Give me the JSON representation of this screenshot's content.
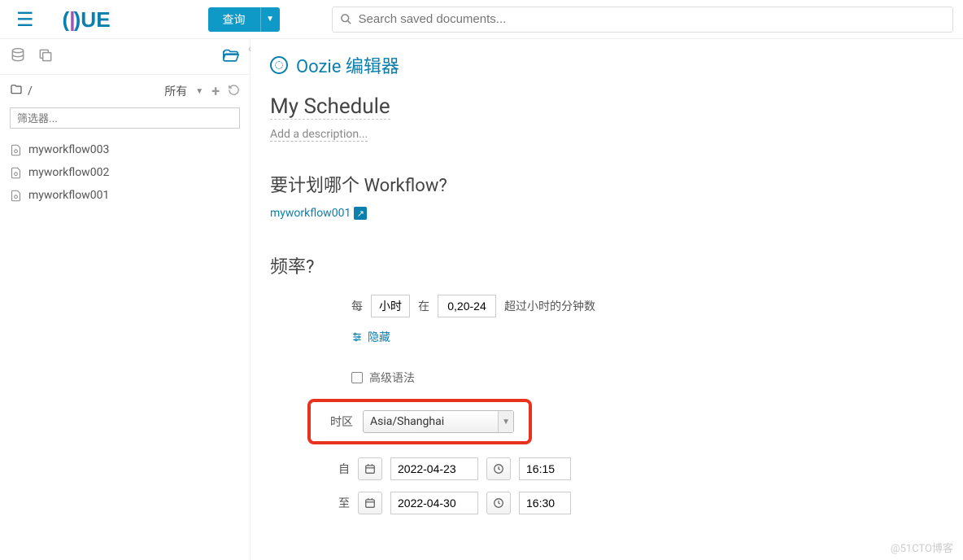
{
  "topbar": {
    "query_label": "查询",
    "search_placeholder": "Search saved documents..."
  },
  "sidebar": {
    "path": "/",
    "filter_label": "所有",
    "filter_placeholder": "筛选器...",
    "files": [
      {
        "name": "myworkflow003"
      },
      {
        "name": "myworkflow002"
      },
      {
        "name": "myworkflow001"
      }
    ]
  },
  "editor": {
    "title": "Oozie 编辑器",
    "schedule_name": "My Schedule",
    "add_description": "Add a description...",
    "which_workflow": "要计划哪个 Workflow?",
    "selected_workflow": "myworkflow001",
    "frequency_title": "频率?",
    "freq": {
      "every": "每",
      "unit": "小时",
      "at": "在",
      "value": "0,20-24",
      "suffix": "超过小时的分钟数",
      "hide": "隐藏"
    },
    "advanced_syntax": "高级语法",
    "timezone_label": "时区",
    "timezone": "Asia/Shanghai",
    "from_label": "自",
    "from_date": "2022-04-23",
    "from_time": "16:15",
    "to_label": "至",
    "to_date": "2022-04-30",
    "to_time": "16:30"
  },
  "watermark": "@51CTO博客"
}
